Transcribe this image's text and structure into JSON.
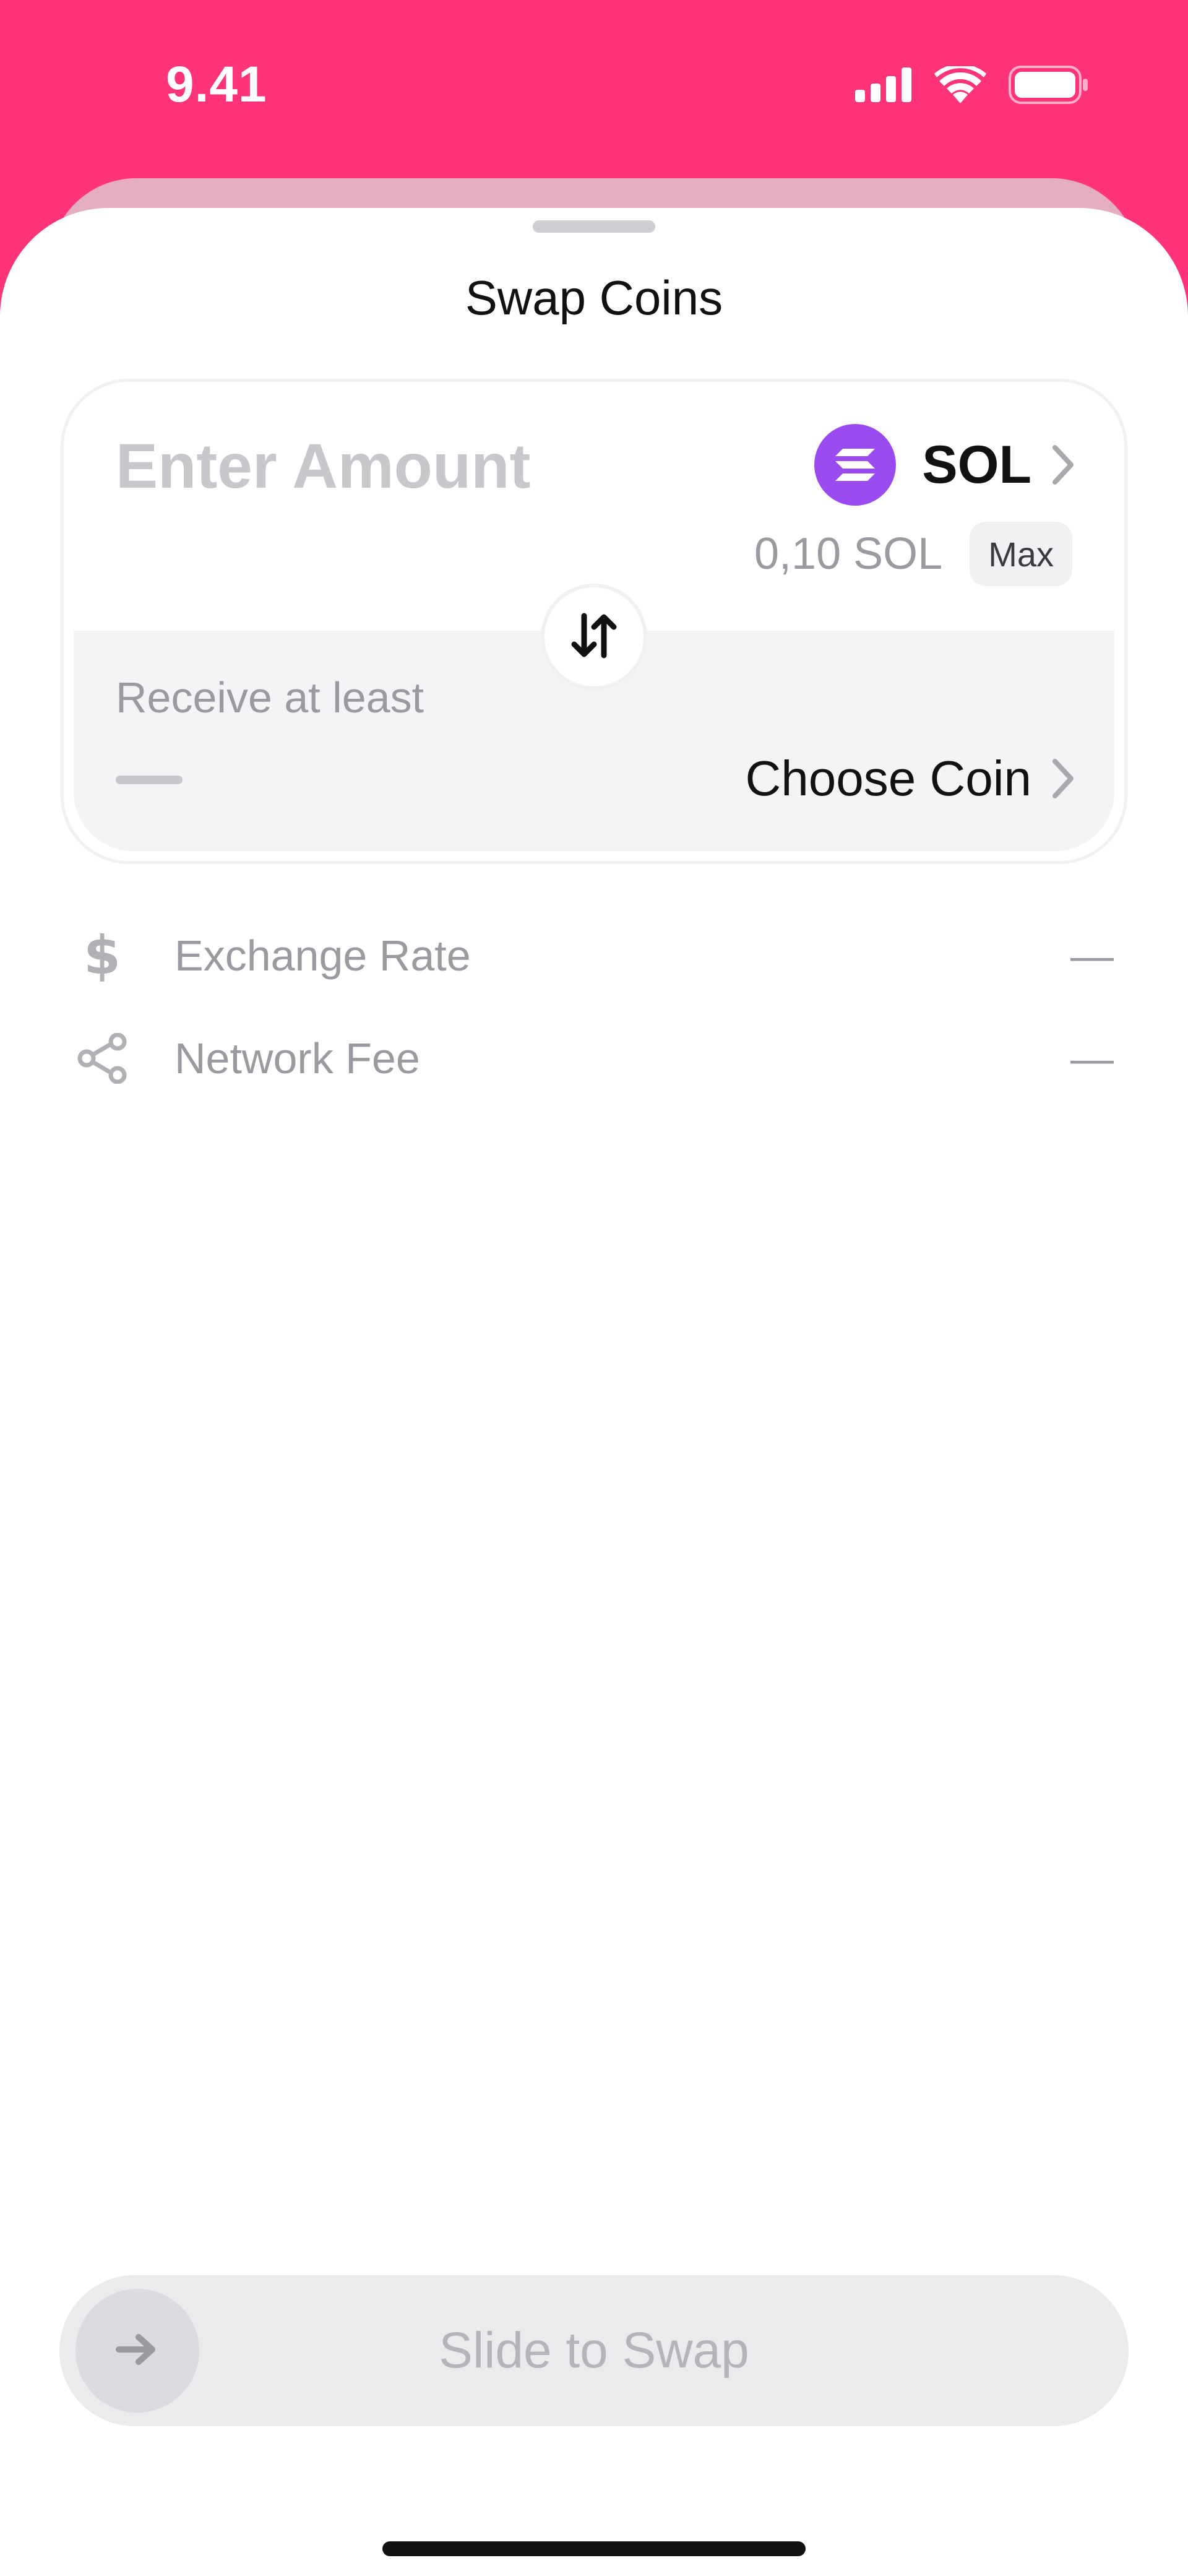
{
  "status_bar": {
    "time": "9.41",
    "icons": [
      "cellular-signal-icon",
      "wifi-icon",
      "battery-icon"
    ]
  },
  "sheet": {
    "title": "Swap Coins"
  },
  "from": {
    "amount_placeholder": "Enter Amount",
    "coin_ticker": "SOL",
    "coin_icon": "solana-logo-icon",
    "balance": "0,10 SOL",
    "max_label": "Max"
  },
  "swap_direction_icon": "swap-vertical-arrows-icon",
  "to": {
    "label": "Receive at least",
    "choose_label": "Choose Coin"
  },
  "info": [
    {
      "icon": "dollar-icon",
      "label": "Exchange Rate",
      "value": "—"
    },
    {
      "icon": "network-nodes-icon",
      "label": "Network Fee",
      "value": "—"
    }
  ],
  "slider": {
    "label": "Slide to Swap",
    "icon": "arrow-right-icon"
  },
  "colors": {
    "brand_pink": "#ff3377",
    "solana_purple": "#9a4bf0",
    "muted_text": "#9a9aa0"
  }
}
